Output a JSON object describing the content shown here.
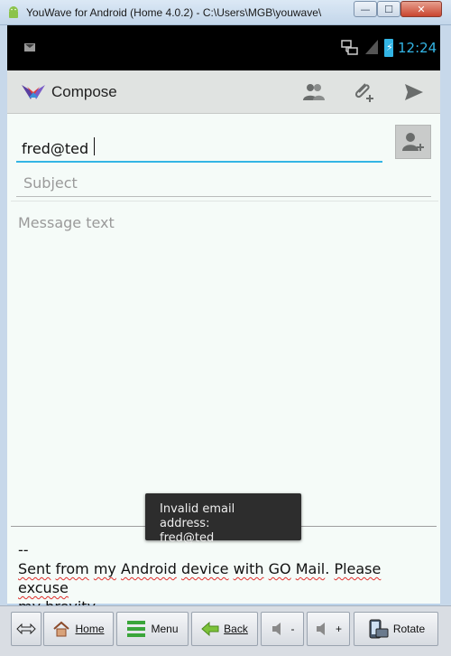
{
  "window": {
    "title": "YouWave for Android (Home 4.0.2) - C:\\Users\\MGB\\youwave\\",
    "min_glyph": "—",
    "max_glyph": "☐",
    "close_glyph": "✕"
  },
  "status_bar": {
    "time": "12:24",
    "accent_color": "#33b5e5"
  },
  "action_bar": {
    "title": "Compose"
  },
  "compose": {
    "to_value": "fred@ted",
    "subject_placeholder": "Subject",
    "message_placeholder": "Message text",
    "signature_dashes": "--",
    "signature_words": [
      "Sent",
      "from",
      "my",
      "Android",
      "device",
      "with",
      "GO",
      "Mail",
      ".",
      "Please",
      "excuse",
      "my",
      "brevity",
      "."
    ]
  },
  "toast": {
    "line1": "Invalid email address:",
    "line2": "fred@ted"
  },
  "toolbar": {
    "home_label": "Home",
    "menu_label": "Menu",
    "back_label": "Back",
    "vol_down_label": "-",
    "vol_up_label": "+",
    "rotate_label": "Rotate"
  }
}
